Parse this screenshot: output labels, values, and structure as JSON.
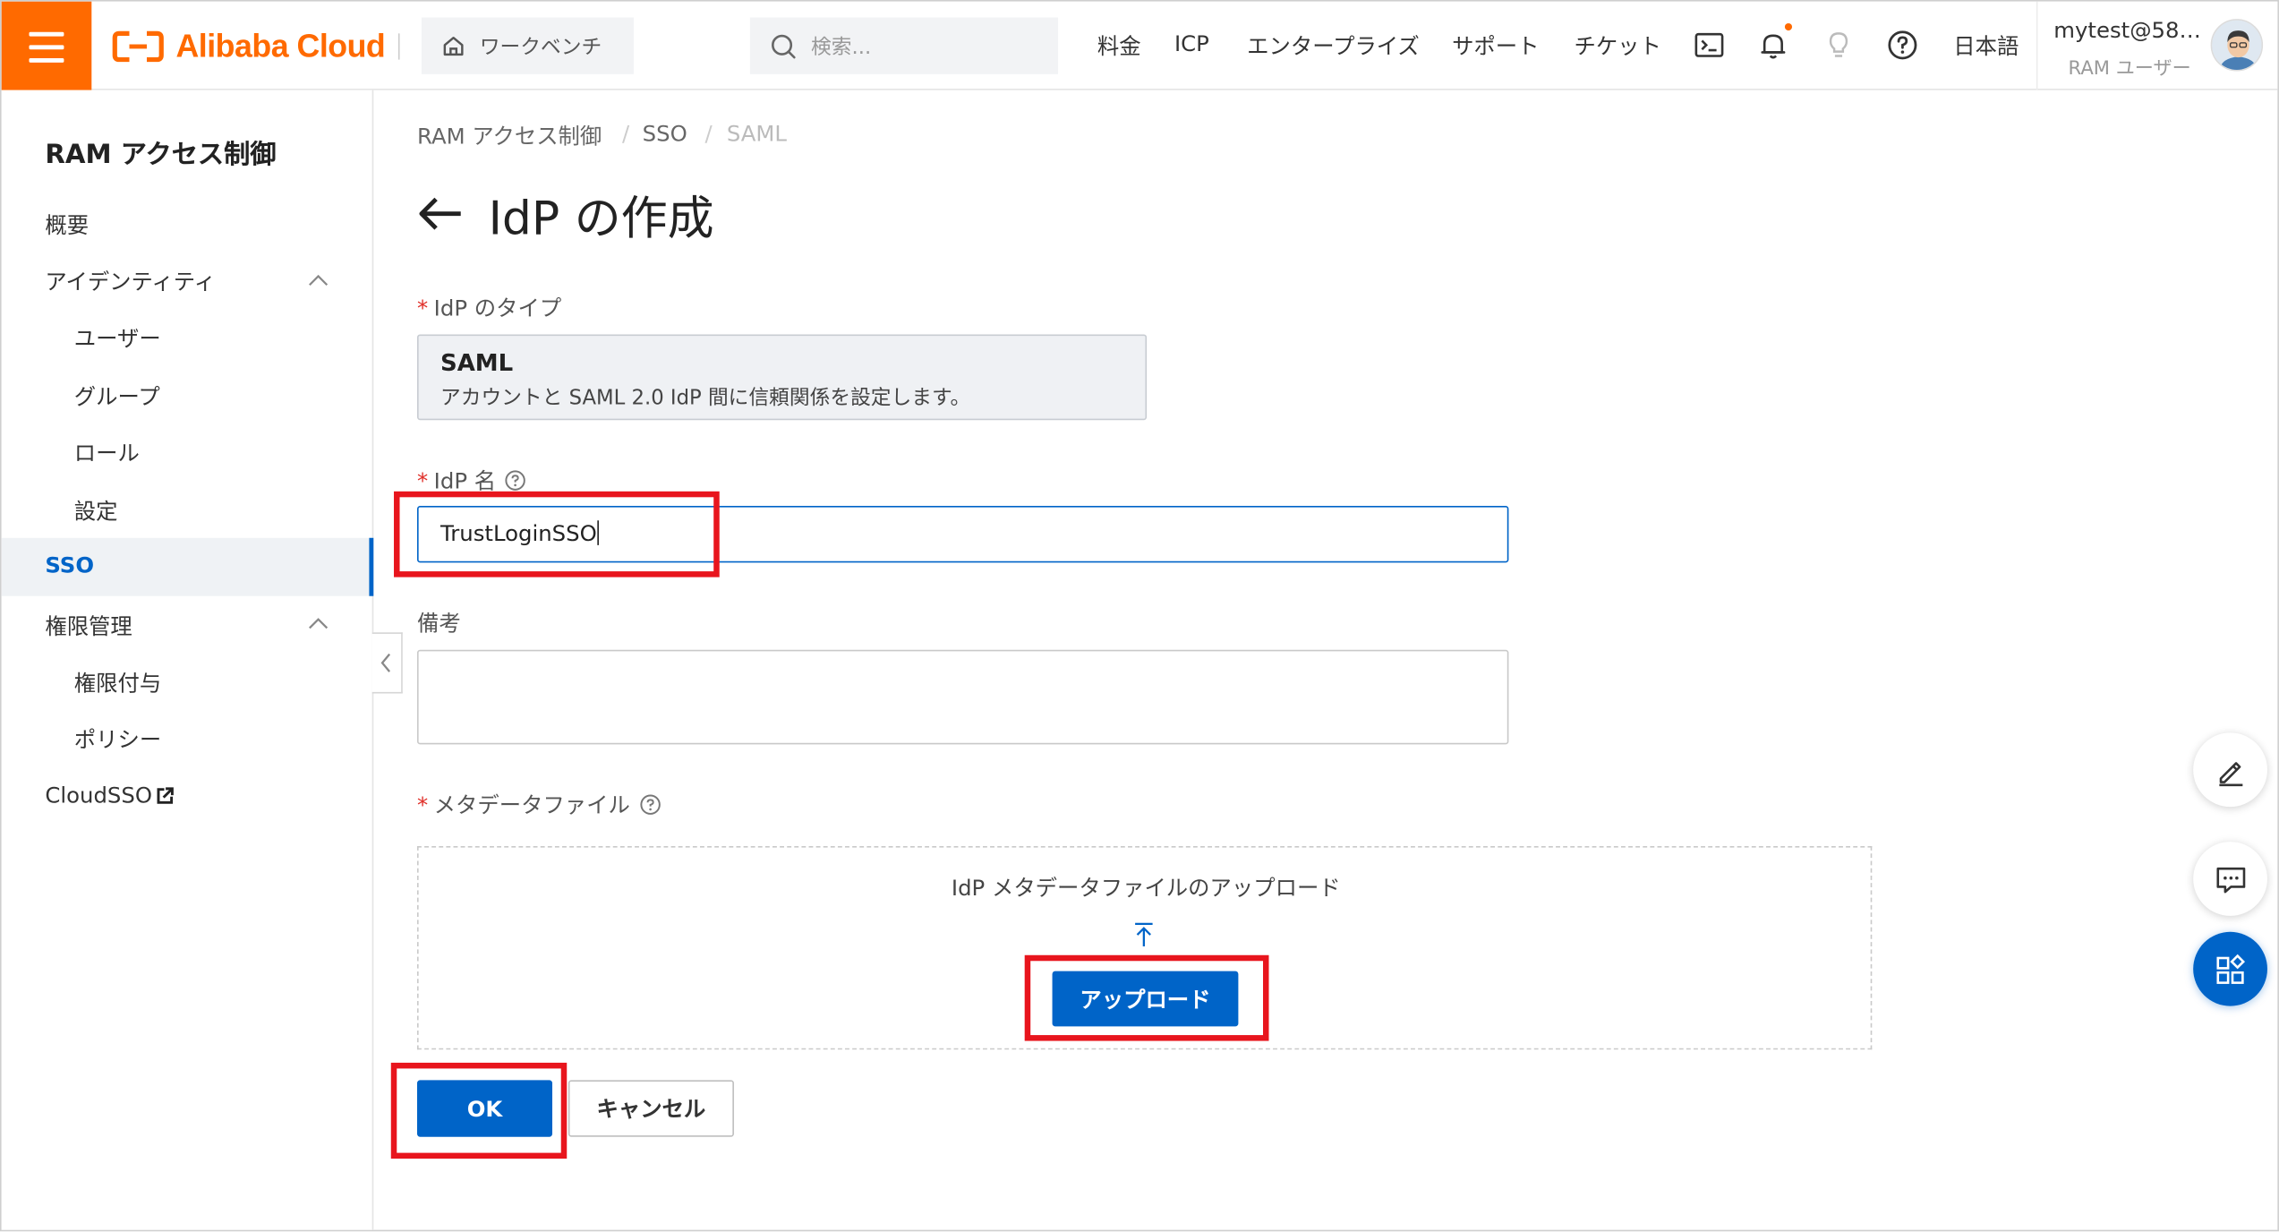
{
  "header": {
    "brand": "Alibaba Cloud",
    "workbench_label": "ワークベンチ",
    "search_placeholder": "検索...",
    "nav": [
      "料金",
      "ICP",
      "エンタープライズ",
      "サポート",
      "チケット"
    ],
    "language": "日本語",
    "user_name": "mytest@58…",
    "user_role": "RAM ユーザー"
  },
  "sidebar": {
    "title": "RAM アクセス制御",
    "items": {
      "overview": "概要",
      "identity": "アイデンティティ",
      "users": "ユーザー",
      "groups": "グループ",
      "roles": "ロール",
      "settings": "設定",
      "sso": "SSO",
      "permission_mgmt": "権限管理",
      "grants": "権限付与",
      "policies": "ポリシー",
      "cloudsso": "CloudSSO"
    },
    "active": "SSO"
  },
  "breadcrumb": [
    "RAM アクセス制御",
    "/",
    "SSO",
    "/",
    "SAML"
  ],
  "page_title": "IdP の作成",
  "form": {
    "idp_type_label": "IdP のタイプ",
    "idp_type_name": "SAML",
    "idp_type_desc": "アカウントと SAML 2.0 IdP 間に信頼関係を設定します。",
    "idp_name_label": "IdP 名",
    "idp_name_value": "TrustLoginSSO",
    "remarks_label": "備考",
    "remarks_value": "",
    "metadata_label": "メタデータファイル",
    "upload_title": "IdP メタデータファイルのアップロード",
    "upload_button": "アップロード",
    "ok_button": "OK",
    "cancel_button": "キャンセル"
  },
  "colors": {
    "brand_orange": "#ff6a00",
    "primary_blue": "#0064c8",
    "highlight_red": "#e8151d",
    "required_red": "#e0302a"
  }
}
